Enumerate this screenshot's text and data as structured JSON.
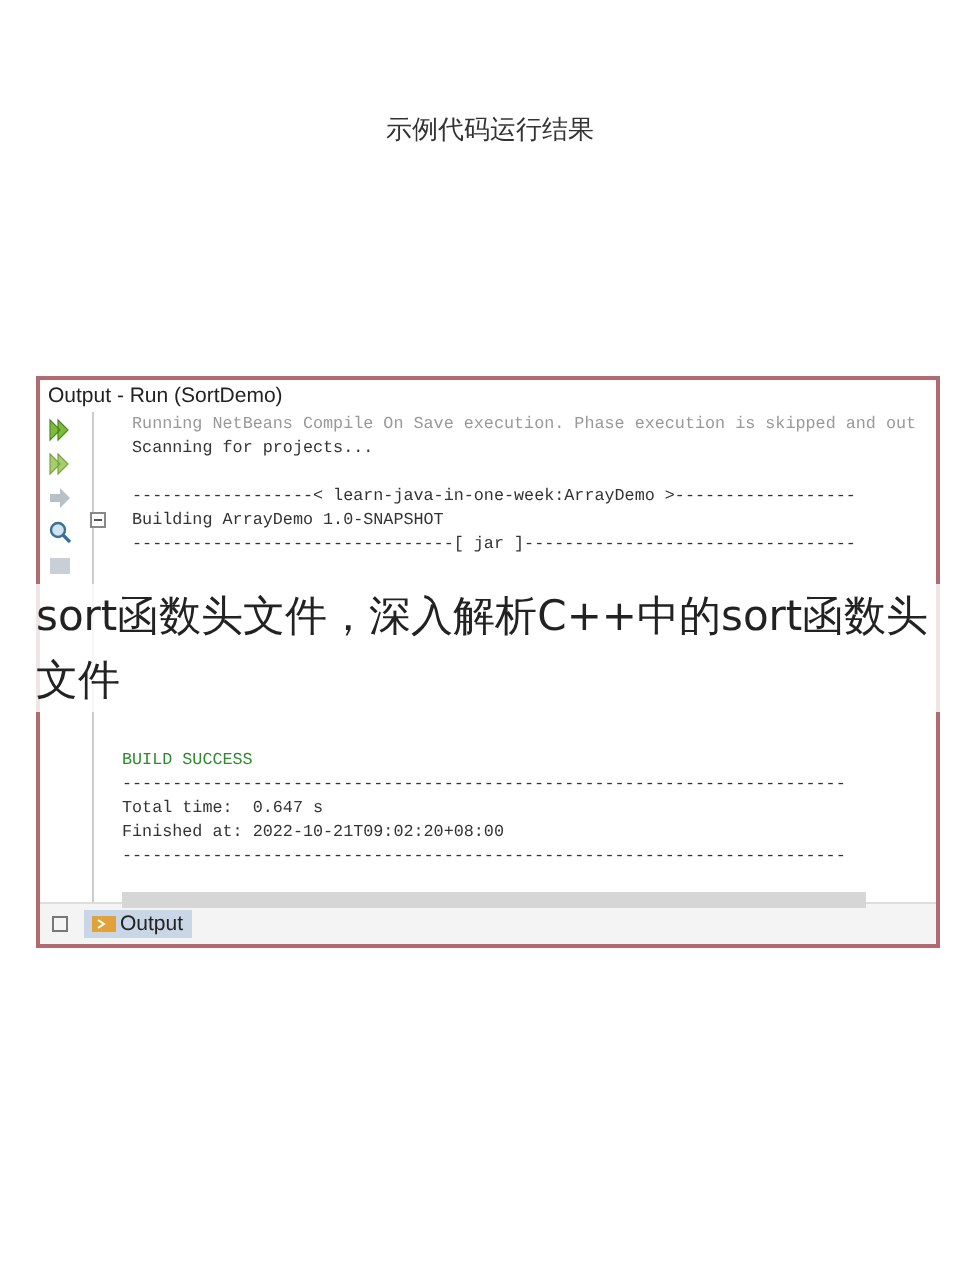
{
  "caption": "示例代码运行结果",
  "panel": {
    "title": "Output - Run (SortDemo)",
    "lines_top": [
      {
        "text": "Running NetBeans Compile On Save execution. Phase execution is skipped and out",
        "kind": "dim"
      },
      {
        "text": "Scanning for projects...",
        "kind": "normal"
      },
      {
        "kind": "blank"
      },
      {
        "text": "------------------< learn-java-in-one-week:ArrayDemo >------------------",
        "kind": "normal"
      },
      {
        "text": "Building ArrayDemo 1.0-SNAPSHOT",
        "kind": "fold"
      },
      {
        "text": "--------------------------------[ jar ]---------------------------------",
        "kind": "normal"
      }
    ],
    "lines_bottom": [
      {
        "text": "BUILD SUCCESS",
        "kind": "success"
      },
      {
        "text": "------------------------------------------------------------------------",
        "kind": "normal"
      },
      {
        "text": "Total time:  0.647 s",
        "kind": "normal"
      },
      {
        "text": "Finished at: 2022-10-21T09:02:20+08:00",
        "kind": "normal"
      },
      {
        "text": "------------------------------------------------------------------------",
        "kind": "normal"
      }
    ],
    "tab": {
      "label": "Output",
      "selected": true
    }
  },
  "overlay_title": "sort函数头文件，深入解析C++中的sort函数头文件"
}
